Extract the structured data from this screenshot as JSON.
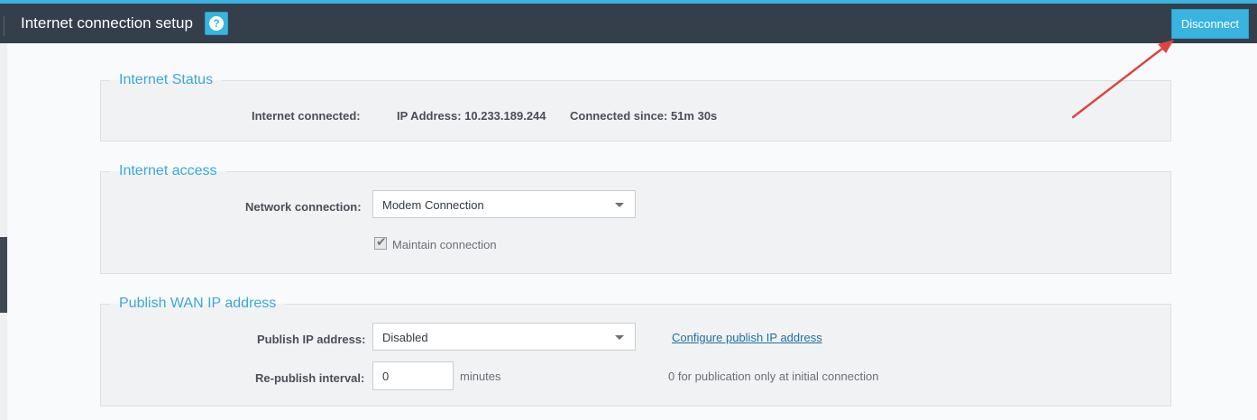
{
  "header": {
    "title": "Internet connection setup",
    "help_icon": "question-circle-icon",
    "disconnect_label": "Disconnect"
  },
  "colors": {
    "accent": "#39b3e0",
    "header_bg": "#353f4b",
    "legend": "#39a9d9",
    "annotation_arrow": "#e0443e"
  },
  "status": {
    "legend": "Internet Status",
    "connected_label": "Internet connected:",
    "ip_text": "IP Address: 10.233.189.244",
    "since_text": "Connected since: 51m 30s"
  },
  "access": {
    "legend": "Internet access",
    "network_label": "Network connection:",
    "network_value": "Modem Connection",
    "maintain_label": "Maintain connection",
    "maintain_checked": true
  },
  "publish": {
    "legend": "Publish WAN IP address",
    "publish_label": "Publish IP address:",
    "publish_value": "Disabled",
    "configure_link": "Configure publish IP address",
    "republish_label": "Re-publish interval:",
    "republish_value": "0",
    "minutes_label": "minutes",
    "hint": "0 for publication only at initial connection"
  }
}
